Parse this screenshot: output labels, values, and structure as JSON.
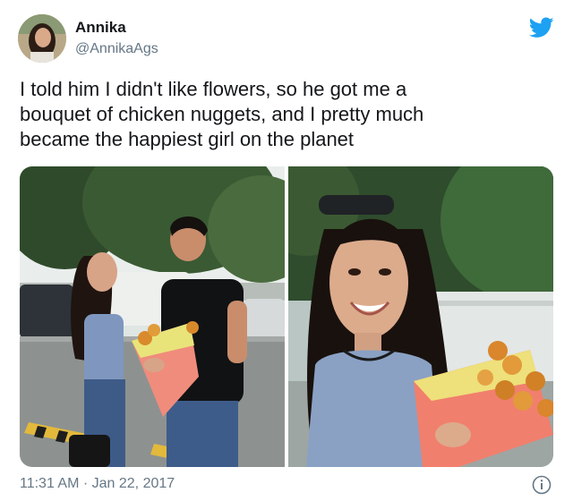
{
  "author": {
    "display_name": "Annika",
    "handle": "@AnnikaAgs",
    "avatar_icon": "profile-photo"
  },
  "brand": {
    "icon": "twitter-bird-icon",
    "color": "#1da1f2"
  },
  "tweet": {
    "text_lines": [
      "I told him I didn't like flowers, so he got me a",
      "bouquet of chicken nuggets, and I pretty much",
      "became the happiest girl on the planet"
    ],
    "timestamp": "11:31 AM · Jan 22, 2017"
  },
  "media": {
    "count": 2
  },
  "footer": {
    "info_icon": "info-icon"
  }
}
